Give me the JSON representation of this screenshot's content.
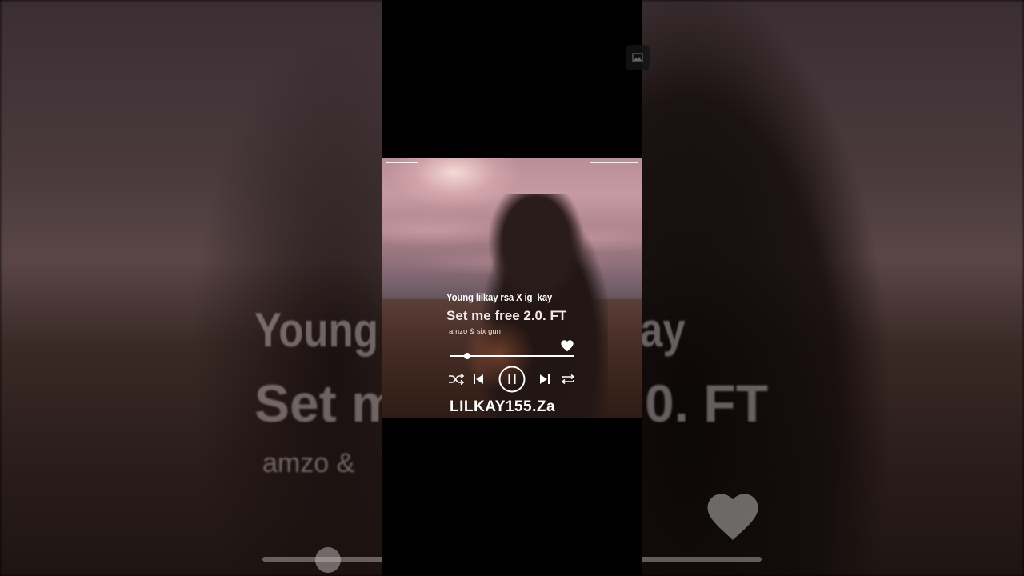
{
  "player": {
    "artist_line": "Young lilkay rsa X ig_kay",
    "track_title": "Set me free 2.0. FT",
    "featuring": "amzo & six gun",
    "brand": "LILKAY155.Za",
    "progress": 0.14
  },
  "background": {
    "line1_left": "Young l",
    "line1_right": "ay",
    "line2_left": "Set m",
    "line2_right": "0. FT",
    "line3_left": "amzo &"
  },
  "icons": {
    "like": "heart-icon",
    "shuffle": "shuffle-icon",
    "previous": "previous-icon",
    "pause": "pause-icon",
    "next": "next-icon",
    "repeat": "repeat-icon",
    "gallery": "image-icon"
  },
  "colors": {
    "accent": "#ffffff",
    "title": "#f4e6ea"
  }
}
